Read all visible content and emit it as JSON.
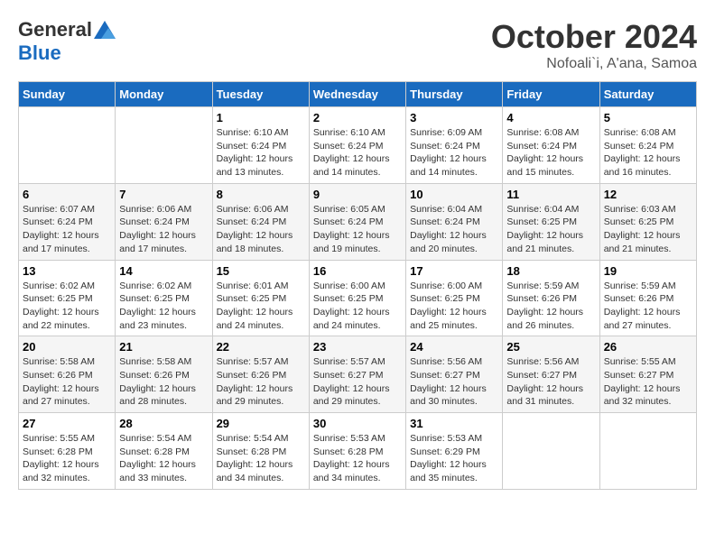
{
  "logo": {
    "general": "General",
    "blue": "Blue"
  },
  "title": "October 2024",
  "location": "Nofoali`i, A'ana, Samoa",
  "days_of_week": [
    "Sunday",
    "Monday",
    "Tuesday",
    "Wednesday",
    "Thursday",
    "Friday",
    "Saturday"
  ],
  "weeks": [
    [
      {
        "day": "",
        "info": ""
      },
      {
        "day": "",
        "info": ""
      },
      {
        "day": "1",
        "info": "Sunrise: 6:10 AM\nSunset: 6:24 PM\nDaylight: 12 hours and 13 minutes."
      },
      {
        "day": "2",
        "info": "Sunrise: 6:10 AM\nSunset: 6:24 PM\nDaylight: 12 hours and 14 minutes."
      },
      {
        "day": "3",
        "info": "Sunrise: 6:09 AM\nSunset: 6:24 PM\nDaylight: 12 hours and 14 minutes."
      },
      {
        "day": "4",
        "info": "Sunrise: 6:08 AM\nSunset: 6:24 PM\nDaylight: 12 hours and 15 minutes."
      },
      {
        "day": "5",
        "info": "Sunrise: 6:08 AM\nSunset: 6:24 PM\nDaylight: 12 hours and 16 minutes."
      }
    ],
    [
      {
        "day": "6",
        "info": "Sunrise: 6:07 AM\nSunset: 6:24 PM\nDaylight: 12 hours and 17 minutes."
      },
      {
        "day": "7",
        "info": "Sunrise: 6:06 AM\nSunset: 6:24 PM\nDaylight: 12 hours and 17 minutes."
      },
      {
        "day": "8",
        "info": "Sunrise: 6:06 AM\nSunset: 6:24 PM\nDaylight: 12 hours and 18 minutes."
      },
      {
        "day": "9",
        "info": "Sunrise: 6:05 AM\nSunset: 6:24 PM\nDaylight: 12 hours and 19 minutes."
      },
      {
        "day": "10",
        "info": "Sunrise: 6:04 AM\nSunset: 6:24 PM\nDaylight: 12 hours and 20 minutes."
      },
      {
        "day": "11",
        "info": "Sunrise: 6:04 AM\nSunset: 6:25 PM\nDaylight: 12 hours and 21 minutes."
      },
      {
        "day": "12",
        "info": "Sunrise: 6:03 AM\nSunset: 6:25 PM\nDaylight: 12 hours and 21 minutes."
      }
    ],
    [
      {
        "day": "13",
        "info": "Sunrise: 6:02 AM\nSunset: 6:25 PM\nDaylight: 12 hours and 22 minutes."
      },
      {
        "day": "14",
        "info": "Sunrise: 6:02 AM\nSunset: 6:25 PM\nDaylight: 12 hours and 23 minutes."
      },
      {
        "day": "15",
        "info": "Sunrise: 6:01 AM\nSunset: 6:25 PM\nDaylight: 12 hours and 24 minutes."
      },
      {
        "day": "16",
        "info": "Sunrise: 6:00 AM\nSunset: 6:25 PM\nDaylight: 12 hours and 24 minutes."
      },
      {
        "day": "17",
        "info": "Sunrise: 6:00 AM\nSunset: 6:25 PM\nDaylight: 12 hours and 25 minutes."
      },
      {
        "day": "18",
        "info": "Sunrise: 5:59 AM\nSunset: 6:26 PM\nDaylight: 12 hours and 26 minutes."
      },
      {
        "day": "19",
        "info": "Sunrise: 5:59 AM\nSunset: 6:26 PM\nDaylight: 12 hours and 27 minutes."
      }
    ],
    [
      {
        "day": "20",
        "info": "Sunrise: 5:58 AM\nSunset: 6:26 PM\nDaylight: 12 hours and 27 minutes."
      },
      {
        "day": "21",
        "info": "Sunrise: 5:58 AM\nSunset: 6:26 PM\nDaylight: 12 hours and 28 minutes."
      },
      {
        "day": "22",
        "info": "Sunrise: 5:57 AM\nSunset: 6:26 PM\nDaylight: 12 hours and 29 minutes."
      },
      {
        "day": "23",
        "info": "Sunrise: 5:57 AM\nSunset: 6:27 PM\nDaylight: 12 hours and 29 minutes."
      },
      {
        "day": "24",
        "info": "Sunrise: 5:56 AM\nSunset: 6:27 PM\nDaylight: 12 hours and 30 minutes."
      },
      {
        "day": "25",
        "info": "Sunrise: 5:56 AM\nSunset: 6:27 PM\nDaylight: 12 hours and 31 minutes."
      },
      {
        "day": "26",
        "info": "Sunrise: 5:55 AM\nSunset: 6:27 PM\nDaylight: 12 hours and 32 minutes."
      }
    ],
    [
      {
        "day": "27",
        "info": "Sunrise: 5:55 AM\nSunset: 6:28 PM\nDaylight: 12 hours and 32 minutes."
      },
      {
        "day": "28",
        "info": "Sunrise: 5:54 AM\nSunset: 6:28 PM\nDaylight: 12 hours and 33 minutes."
      },
      {
        "day": "29",
        "info": "Sunrise: 5:54 AM\nSunset: 6:28 PM\nDaylight: 12 hours and 34 minutes."
      },
      {
        "day": "30",
        "info": "Sunrise: 5:53 AM\nSunset: 6:28 PM\nDaylight: 12 hours and 34 minutes."
      },
      {
        "day": "31",
        "info": "Sunrise: 5:53 AM\nSunset: 6:29 PM\nDaylight: 12 hours and 35 minutes."
      },
      {
        "day": "",
        "info": ""
      },
      {
        "day": "",
        "info": ""
      }
    ]
  ]
}
